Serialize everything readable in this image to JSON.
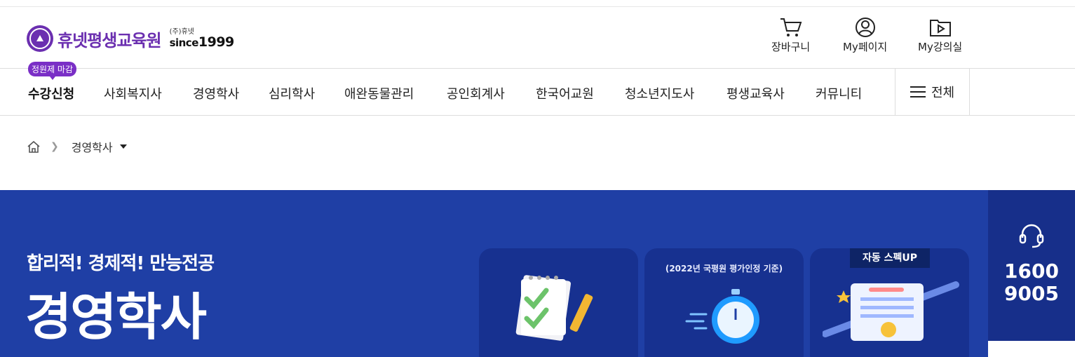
{
  "header": {
    "brand_name": "휴넷평생교육원",
    "company": "(주)휴넷",
    "since_word": "since",
    "since_year": "1999",
    "utility": [
      {
        "label": "장바구니",
        "icon": "cart-icon"
      },
      {
        "label": "My페이지",
        "icon": "user-icon"
      },
      {
        "label": "My강의실",
        "icon": "play-folder-icon"
      }
    ]
  },
  "gnb": {
    "badge": "정원제 마감",
    "items": [
      "수강신청",
      "사회복지사",
      "경영학사",
      "심리학사",
      "애완동물관리",
      "공인회계사",
      "한국어교원",
      "청소년지도사",
      "평생교육사",
      "커뮤니티"
    ],
    "all_menu_label": "전체"
  },
  "breadcrumb": {
    "home_icon": "home-icon",
    "current": "경영학사"
  },
  "hero": {
    "subtitle": "합리적! 경제적! 만능전공",
    "title": "경영학사",
    "cards": [
      {
        "note": "",
        "tag": "",
        "icon": "checklist-pencil-icon"
      },
      {
        "note": "(2022년 국평원 평가인정 기준)",
        "tag": "",
        "icon": "stopwatch-icon"
      },
      {
        "note": "",
        "tag": "자동 스펙UP",
        "icon": "certificate-icon"
      }
    ],
    "colors": {
      "background": "#1f3fa5",
      "card": "#173190",
      "accent": "#6b2fb0"
    }
  },
  "customer_center": {
    "icon": "headset-icon",
    "phone_line1": "1600",
    "phone_line2": "9005"
  }
}
